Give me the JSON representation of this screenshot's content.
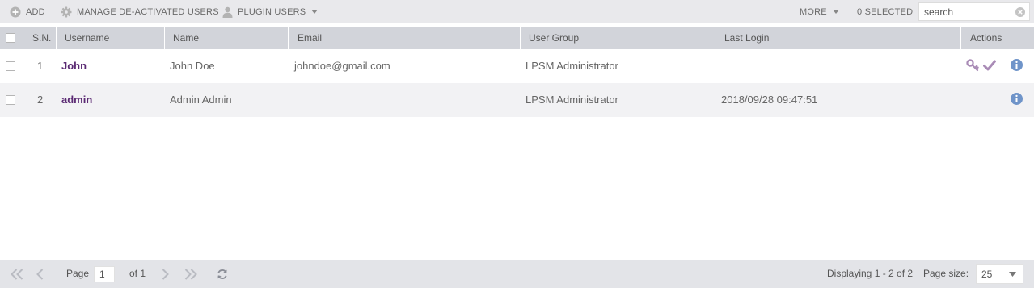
{
  "toolbar": {
    "add_label": "ADD",
    "manage_label": "MANAGE DE-ACTIVATED USERS",
    "plugin_label": "PLUGIN USERS",
    "more_label": "MORE",
    "selected_label": "0 SELECTED",
    "search_placeholder": "search"
  },
  "table": {
    "columns": [
      "S.N.",
      "Username",
      "Name",
      "Email",
      "User Group",
      "Last Login",
      "Actions"
    ],
    "rows": [
      {
        "sn": "1",
        "username": "John",
        "name": "John Doe",
        "email": "johndoe@gmail.com",
        "group": "LPSM Administrator",
        "last_login": "",
        "actions": [
          "key-icon",
          "check-icon",
          "info-icon"
        ]
      },
      {
        "sn": "2",
        "username": "admin",
        "name": "Admin Admin",
        "email": "",
        "group": "LPSM Administrator",
        "last_login": "2018/09/28 09:47:51",
        "actions": [
          "info-icon"
        ]
      }
    ]
  },
  "pager": {
    "page_label": "Page",
    "page_value": "1",
    "of_label": "of 1",
    "displaying": "Displaying 1 - 2 of 2",
    "page_size_label": "Page size:",
    "page_size_value": "25"
  },
  "colors": {
    "accent": "#5b2a73",
    "action_icon": "#a98bb6",
    "info_icon": "#6f94c9",
    "toolbar_bg": "#e9e9ec",
    "header_bg": "#d2d4da"
  }
}
